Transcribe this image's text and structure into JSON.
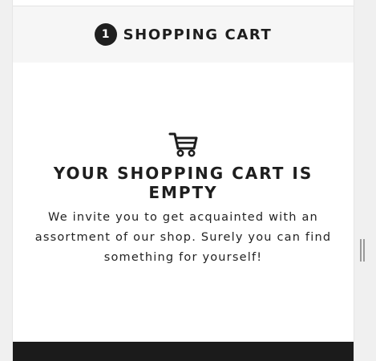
{
  "header": {
    "step_number": "1",
    "title": "SHOPPING CART"
  },
  "empty_state": {
    "icon": "cart-icon",
    "title": "YOUR SHOPPING CART IS EMPTY",
    "description": "We invite you to get acquainted with an assortment of our shop. Surely you can find something for yourself!"
  },
  "colors": {
    "badge": "#1f1f1f",
    "header_bg": "#f6f6f6",
    "footer_bg": "#1b1b1b",
    "text": "#1e1e1e"
  }
}
